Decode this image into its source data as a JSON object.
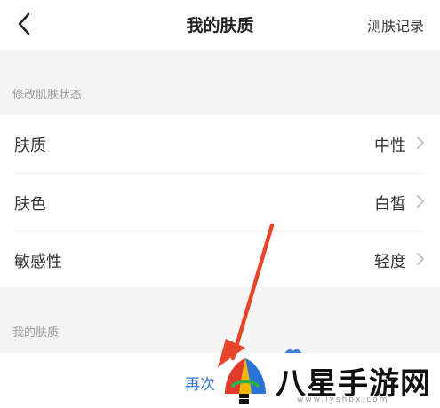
{
  "header": {
    "title": "我的肤质",
    "record_label": "测肤记录"
  },
  "sections": {
    "modify_label": "修改肌肤状态",
    "my_skin_label": "我的肤质"
  },
  "list": [
    {
      "label": "肤质",
      "value": "中性"
    },
    {
      "label": "肤色",
      "value": "白皙"
    },
    {
      "label": "敏感性",
      "value": "轻度"
    }
  ],
  "bottom": {
    "retest_label": "再次"
  },
  "watermark": {
    "text": "八星手游网",
    "url": "www.lyshbx.com"
  },
  "colors": {
    "accent": "#3a7bd5",
    "arrow": "#e8442a"
  },
  "icons": [
    "back-chevron-icon",
    "chevron-right-icon",
    "red-arrow-annotation"
  ]
}
